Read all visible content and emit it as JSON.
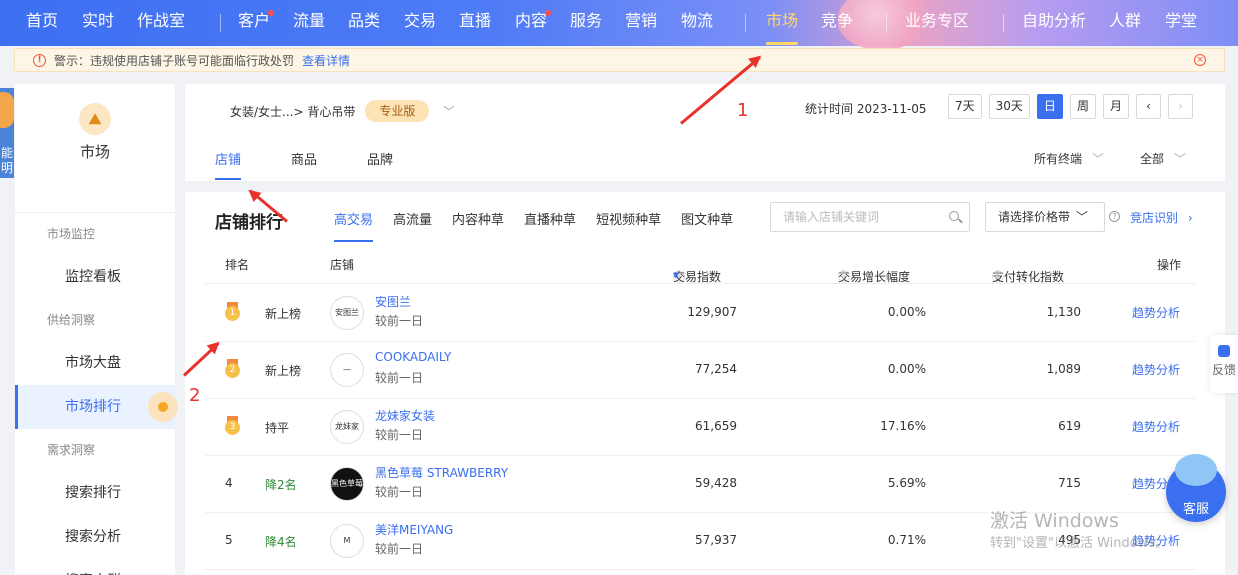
{
  "topnav": {
    "items": [
      "首页",
      "实时",
      "作战室",
      "客户",
      "流量",
      "品类",
      "交易",
      "直播",
      "内容",
      "服务",
      "营销",
      "物流",
      "市场",
      "竞争",
      "业务专区",
      "自助分析",
      "人群",
      "学堂"
    ],
    "active": "市场"
  },
  "warning": {
    "text": "警示：违规使用店铺子账号可能面临行政处罚",
    "link": "查看详情"
  },
  "left_strip": {
    "text": "能明"
  },
  "sidebar": {
    "title": "市场",
    "groups": [
      {
        "label": "市场监控",
        "items": [
          "监控看板"
        ]
      },
      {
        "label": "供给洞察",
        "items": [
          "市场大盘",
          "市场排行"
        ]
      },
      {
        "label": "需求洞察",
        "items": [
          "搜索排行",
          "搜索分析",
          "搜索人群"
        ]
      }
    ],
    "active": "市场排行"
  },
  "header": {
    "breadcrumb": "女装/女士...> 背心吊带",
    "badge": "专业版",
    "stat_time": "统计时间 2023-11-05",
    "range_buttons": [
      "7天",
      "30天",
      "日",
      "周",
      "月"
    ],
    "active_range": "日",
    "tabs": [
      "店铺",
      "商品",
      "品牌"
    ],
    "active_tab": "店铺",
    "filter_terminal": "所有终端",
    "filter_all": "全部"
  },
  "ranking": {
    "title": "店铺排行",
    "tabs": [
      "高交易",
      "高流量",
      "内容种草",
      "直播种草",
      "短视频种草",
      "图文种草"
    ],
    "active_tab": "高交易",
    "search_placeholder": "请输入店铺关键词",
    "price_select": "请选择价格带",
    "compare_link": "竞店识别",
    "columns": [
      "排名",
      "店铺",
      "交易指数",
      "交易增长幅度",
      "支付转化指数",
      "操作"
    ],
    "rows": [
      {
        "rank": "1",
        "change": "新上榜",
        "name": "安图兰",
        "sub": "较前一日",
        "trade_index": "129,907",
        "growth": "0.00%",
        "conversion": "1,130",
        "op": "趋势分析",
        "logo": "安图兰"
      },
      {
        "rank": "2",
        "change": "新上榜",
        "name": "COOKADAILY",
        "sub": "较前一日",
        "trade_index": "77,254",
        "growth": "0.00%",
        "conversion": "1,089",
        "op": "趋势分析",
        "logo": "—"
      },
      {
        "rank": "3",
        "change": "持平",
        "name": "龙妹家女装",
        "sub": "较前一日",
        "trade_index": "61,659",
        "growth": "17.16%",
        "conversion": "619",
        "op": "趋势分析",
        "logo": "龙妹家"
      },
      {
        "rank": "4",
        "change": "降2名",
        "name": "黑色草莓 STRAWBERRY",
        "sub": "较前一日",
        "trade_index": "59,428",
        "growth": "5.69%",
        "conversion": "715",
        "op": "趋势分析",
        "logo": "黑色草莓"
      },
      {
        "rank": "5",
        "change": "降4名",
        "name": "美洋MEIYANG",
        "sub": "较前一日",
        "trade_index": "57,937",
        "growth": "0.71%",
        "conversion": "495",
        "op": "趋势分析",
        "logo": "M"
      }
    ]
  },
  "annotations": {
    "label1": "1",
    "label2": "2"
  },
  "feedback": "反馈",
  "customer_service": "客服",
  "watermark": {
    "line1": "激活 Windows",
    "line2": "转到\"设置\"以激活 Windows。"
  },
  "colors": {
    "accent": "#3a6ff0",
    "nav_active": "#ffd866",
    "annotation": "#e8322b",
    "down": "#2e8b3a"
  }
}
